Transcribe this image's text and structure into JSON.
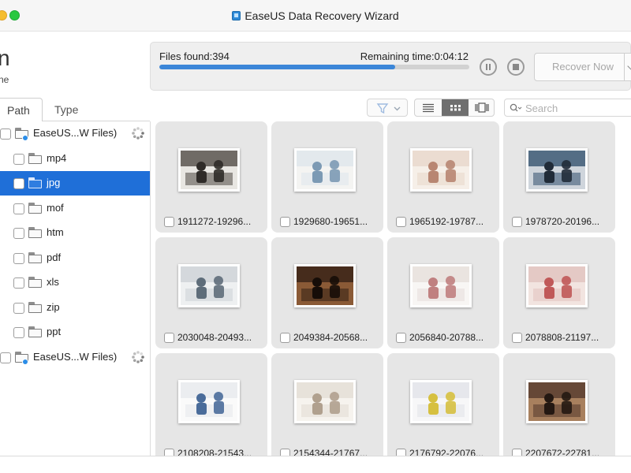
{
  "window": {
    "title": "EaseUS Data Recovery Wizard",
    "app_icon": "easeus-app-icon"
  },
  "left_header": {
    "big_text": "n",
    "small_text": "ne"
  },
  "scan": {
    "files_found_label": "Files found:394",
    "remaining_label": "Remaining time:0:04:12",
    "progress_fraction": 0.76,
    "recover_label": "Recover Now"
  },
  "tabs": [
    {
      "label": "Path",
      "active": true
    },
    {
      "label": "Type",
      "active": false
    }
  ],
  "tree": [
    {
      "label": "EaseUS...W Files)",
      "kind": "device",
      "indent": 0,
      "selected": false,
      "spinner": true
    },
    {
      "label": "mp4",
      "kind": "folder",
      "indent": 1,
      "selected": false
    },
    {
      "label": "jpg",
      "kind": "folder",
      "indent": 1,
      "selected": true
    },
    {
      "label": "mof",
      "kind": "folder",
      "indent": 1,
      "selected": false
    },
    {
      "label": "htm",
      "kind": "folder",
      "indent": 1,
      "selected": false
    },
    {
      "label": "pdf",
      "kind": "folder",
      "indent": 1,
      "selected": false
    },
    {
      "label": "xls",
      "kind": "folder",
      "indent": 1,
      "selected": false
    },
    {
      "label": "zip",
      "kind": "folder",
      "indent": 1,
      "selected": false
    },
    {
      "label": "ppt",
      "kind": "folder",
      "indent": 1,
      "selected": false
    },
    {
      "label": "EaseUS...W Files)",
      "kind": "device",
      "indent": 0,
      "selected": false,
      "spinner": true
    }
  ],
  "toolbar": {
    "search_placeholder": "Search",
    "view_modes": [
      "list-view-icon",
      "grid-view-icon",
      "filmstrip-view-icon"
    ],
    "active_view": "grid-view-icon",
    "filter_icon": "filter-icon"
  },
  "files": [
    {
      "name": "1911272-19296...",
      "colors": [
        "#5a5550",
        "#e8e6e2",
        "#2f2b28"
      ]
    },
    {
      "name": "1929680-19651...",
      "colors": [
        "#dfe6ec",
        "#f4f4f2",
        "#7c9ab4"
      ]
    },
    {
      "name": "1965192-19787...",
      "colors": [
        "#e9d8cc",
        "#f6efe8",
        "#b88672"
      ]
    },
    {
      "name": "1978720-20196...",
      "colors": [
        "#3e5a76",
        "#cfd5dc",
        "#202b38"
      ]
    },
    {
      "name": "2030048-20493...",
      "colors": [
        "#cfd4d8",
        "#eef0f1",
        "#5e6d7a"
      ]
    },
    {
      "name": "2049384-20568...",
      "colors": [
        "#3a2418",
        "#8a5a36",
        "#160d08"
      ]
    },
    {
      "name": "2056840-20788...",
      "colors": [
        "#e8e0dc",
        "#f8f6f4",
        "#c08080"
      ]
    },
    {
      "name": "2078808-21197...",
      "colors": [
        "#e2c4bf",
        "#f2e4e0",
        "#c05858"
      ]
    },
    {
      "name": "2108208-21543...",
      "colors": [
        "#e7eaed",
        "#fafafa",
        "#4a6c9a"
      ]
    },
    {
      "name": "2154344-21767...",
      "colors": [
        "#e4ded6",
        "#f6f3ee",
        "#b0a08e"
      ]
    },
    {
      "name": "2176792-22076...",
      "colors": [
        "#e3e4ea",
        "#f7f7f8",
        "#d6c040"
      ]
    },
    {
      "name": "2207672-22781...",
      "colors": [
        "#5a3e30",
        "#a8805e",
        "#241812"
      ]
    }
  ]
}
